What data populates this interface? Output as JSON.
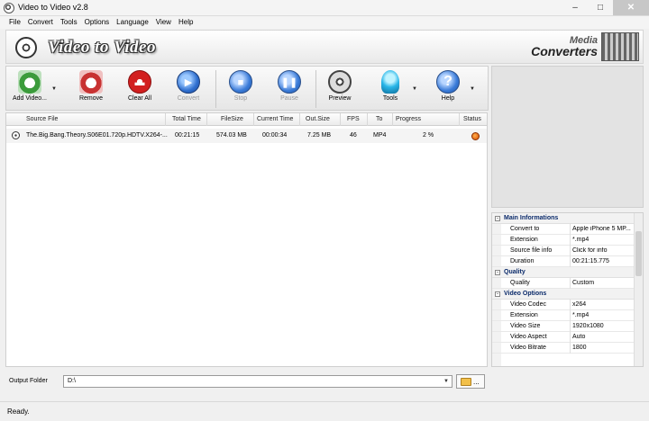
{
  "window": {
    "title": "Video to Video v2.8"
  },
  "menu": [
    "File",
    "Convert",
    "Tools",
    "Options",
    "Language",
    "View",
    "Help"
  ],
  "banner": {
    "brand": "Video to Video",
    "publisher_line1": "Media",
    "publisher_line2": "Converters"
  },
  "toolbar": {
    "add": "Add Video...",
    "remove": "Remove",
    "clear": "Clear All",
    "convert": "Convert",
    "stop": "Stop",
    "pause": "Pause",
    "preview": "Preview",
    "tools": "Tools",
    "help": "Help"
  },
  "filelist": {
    "columns": [
      "Source File",
      "Total Time",
      "FileSize",
      "Current Time",
      "Out.Size",
      "FPS",
      "To",
      "Progress",
      "Status"
    ],
    "rows": [
      {
        "source": "The.Big.Bang.Theory.S06E01.720p.HDTV.X264-...",
        "total_time": "00:21:15",
        "filesize": "574.03 MB",
        "current_time": "00:00:34",
        "out_size": "7.25 MB",
        "fps": "46",
        "to": "MP4",
        "progress": "2 %"
      }
    ]
  },
  "properties": {
    "main": {
      "title": "Main Informations",
      "rows": [
        {
          "k": "Convert to",
          "v": "Apple iPhone 5 MP..."
        },
        {
          "k": "Extension",
          "v": "*.mp4"
        },
        {
          "k": "Source file info",
          "v": "Click for info"
        },
        {
          "k": "Duration",
          "v": "00:21:15.775"
        }
      ]
    },
    "quality": {
      "title": "Quality",
      "rows": [
        {
          "k": "Quality",
          "v": "Custom"
        }
      ]
    },
    "video": {
      "title": "Video Options",
      "rows": [
        {
          "k": "Video Codec",
          "v": "x264"
        },
        {
          "k": "Extension",
          "v": "*.mp4"
        },
        {
          "k": "Video Size",
          "v": "1920x1080"
        },
        {
          "k": "Video Aspect",
          "v": "Auto"
        },
        {
          "k": "Video Bitrate",
          "v": "1800"
        }
      ]
    }
  },
  "output": {
    "label": "Output Folder",
    "value": "D:\\"
  },
  "status": {
    "text": "Ready."
  }
}
